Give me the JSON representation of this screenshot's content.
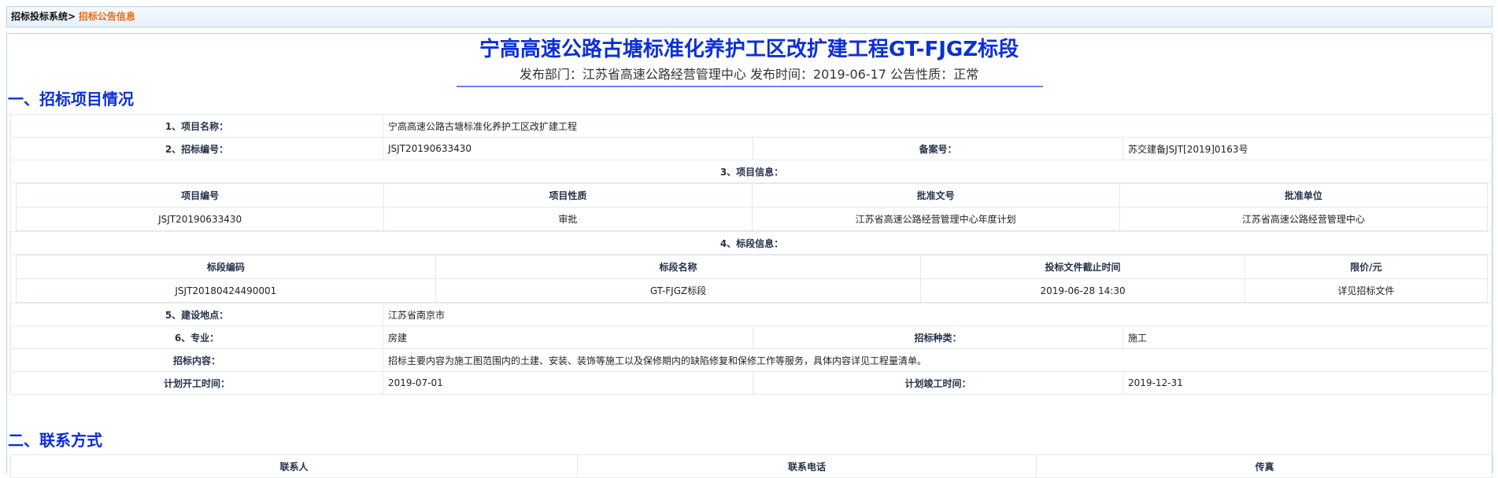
{
  "breadcrumb": {
    "root": "招标投标系统",
    "separator": ">",
    "current": "招标公告信息"
  },
  "announcement": {
    "title": "宁高高速公路古塘标准化养护工区改扩建工程GT-FJGZ标段",
    "meta": "发布部门：江苏省高速公路经营管理中心 发布时间：2019-06-17 公告性质：正常"
  },
  "sections": {
    "project": "一、招标项目情况",
    "contact": "二、联系方式"
  },
  "project": {
    "name_label": "1、项目名称：",
    "name": "宁高高速公路古塘标准化养护工区改扩建工程",
    "bid_no_label": "2、招标编号：",
    "bid_no": "JSJT20190633430",
    "record_no_label": "备案号：",
    "record_no": "苏交建备JSJT[2019]0163号",
    "info_label": "3、项目信息：",
    "info_headers": [
      "项目编号",
      "项目性质",
      "批准文号",
      "批准单位"
    ],
    "info_row": [
      "JSJT20190633430",
      "审批",
      "江苏省高速公路经营管理中心年度计划",
      "江苏省高速公路经营管理中心"
    ],
    "section_info_label": "4、标段信息：",
    "section_headers": [
      "标段编码",
      "标段名称",
      "投标文件截止时间",
      "限价/元"
    ],
    "section_row": [
      "JSJT20180424490001",
      "GT-FJGZ标段",
      "2019-06-28 14:30",
      "详见招标文件"
    ],
    "location_label": "5、建设地点：",
    "location": "江苏省南京市",
    "specialty_label": "6、专业：",
    "specialty": "房建",
    "bid_type_label": "招标种类：",
    "bid_type": "施工",
    "content_label": "招标内容：",
    "content": "招标主要内容为施工图范围内的土建、安装、装饰等施工以及保修期内的缺陷修复和保修工作等服务，具体内容详见工程量清单。",
    "plan_start_label": "计划开工时间：",
    "plan_start": "2019-07-01",
    "plan_end_label": "计划竣工时间：",
    "plan_end": "2019-12-31"
  },
  "contact": {
    "headers": [
      "联系人",
      "联系电话",
      "传真"
    ]
  }
}
